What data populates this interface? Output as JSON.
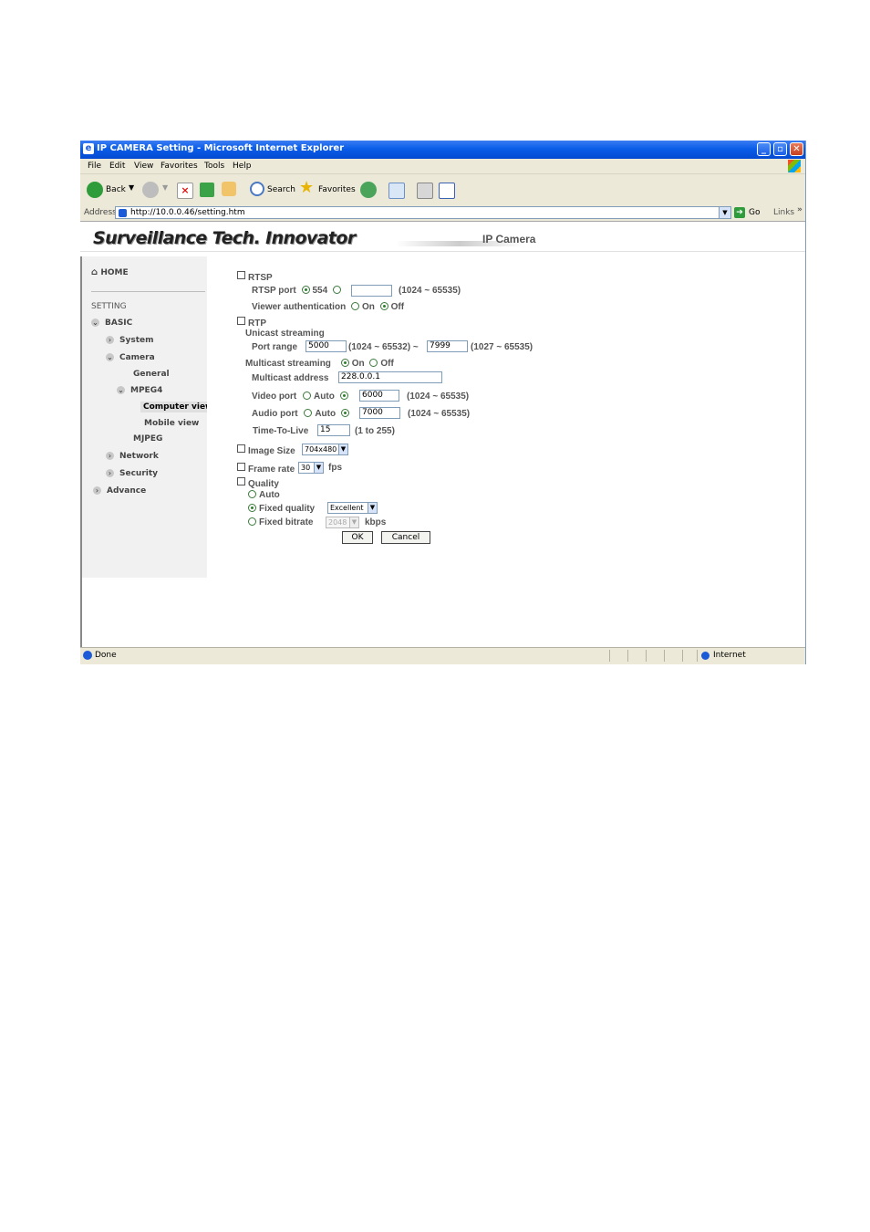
{
  "window": {
    "title": "IP CAMERA Setting - Microsoft Internet Explorer"
  },
  "menu": [
    "File",
    "Edit",
    "View",
    "Favorites",
    "Tools",
    "Help"
  ],
  "toolbar": {
    "back": "Back",
    "search": "Search",
    "favorites": "Favorites"
  },
  "address": {
    "label": "Address",
    "url": "http://10.0.0.46/setting.htm",
    "go": "Go",
    "links": "Links"
  },
  "banner": {
    "brand": "Surveillance Tech. Innovator",
    "product": "IP Camera"
  },
  "sidebar": {
    "home": "HOME",
    "setting": "SETTING",
    "basic": "BASIC",
    "system": "System",
    "camera": "Camera",
    "general": "General",
    "mpeg4": "MPEG4",
    "computer_view": "Computer view",
    "mobile_view": "Mobile view",
    "mjpeg": "MJPEG",
    "network": "Network",
    "security": "Security",
    "advance": "Advance"
  },
  "form": {
    "rtsp": {
      "section": "RTSP",
      "port_label": "RTSP port",
      "port_default": "554",
      "port_custom_value": "",
      "port_range": "(1024 ~ 65535)",
      "viewer_auth_label": "Viewer authentication",
      "on": "On",
      "off": "Off"
    },
    "rtp": {
      "section": "RTP",
      "unicast_label": "Unicast streaming",
      "port_range_label": "Port range",
      "port_start": "5000",
      "port_start_range": "(1024 ~ 65532) ~",
      "port_end": "7999",
      "port_end_range": "(1027 ~ 65535)",
      "multicast_label": "Multicast streaming",
      "on": "On",
      "off": "Off",
      "multicast_address_label": "Multicast address",
      "multicast_address": "228.0.0.1",
      "video_port_label": "Video port",
      "video_auto": "Auto",
      "video_port": "6000",
      "video_range": "(1024 ~ 65535)",
      "audio_port_label": "Audio port",
      "audio_auto": "Auto",
      "audio_port": "7000",
      "audio_range": "(1024 ~ 65535)",
      "ttl_label": "Time-To-Live",
      "ttl": "15",
      "ttl_range": "(1 to 255)"
    },
    "image_size": {
      "label": "Image Size",
      "value": "704x480"
    },
    "frame_rate": {
      "label": "Frame rate",
      "value": "30",
      "unit": "fps"
    },
    "quality": {
      "label": "Quality",
      "auto": "Auto",
      "fixed_quality": "Fixed quality",
      "fixed_quality_value": "Excellent",
      "fixed_bitrate": "Fixed bitrate",
      "fixed_bitrate_value": "2048",
      "unit": "kbps"
    },
    "ok": "OK",
    "cancel": "Cancel"
  },
  "status": {
    "text": "Done",
    "zone": "Internet"
  }
}
